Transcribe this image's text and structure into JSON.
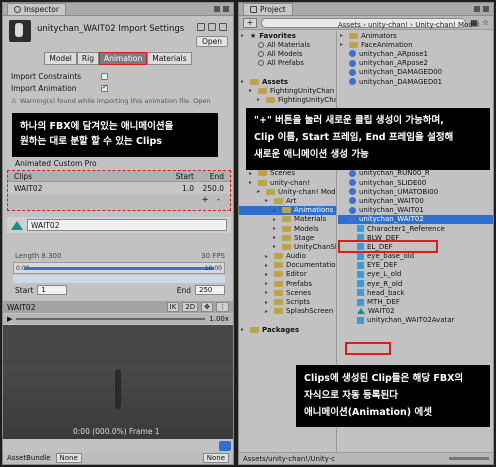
{
  "inspector": {
    "tab_label": "Inspector",
    "title": "unitychan_WAIT02 Import Settings",
    "open_label": "Open",
    "tabs": [
      "Model",
      "Rig",
      "Animation",
      "Materials"
    ],
    "import_constraints_label": "Import Constraints",
    "import_animation_label": "Import Animation",
    "warning_text": "Warning(s) found while importing this animation file. Open",
    "overlay_text_line1": "하나의 FBX에 담겨있는 애니메이션을",
    "overlay_text_line2": "원하는 대로 분할 할 수 있는 Clips",
    "animated_custom_label": "Animated Custom Pro",
    "clips": {
      "headers": [
        "Clips",
        "Start",
        "End"
      ],
      "rows": [
        {
          "name": "WAIT02",
          "start": "1.0",
          "end": "250.0"
        }
      ],
      "add_label": "+",
      "remove_label": "-"
    },
    "clip_name": "WAIT02",
    "length_label": "Length",
    "length_value": "8.300",
    "fps_label": "30 FPS",
    "timeline_start": "0:00",
    "timeline_end": "10:00",
    "start_label": "Start",
    "start_value": "1",
    "end_label": "End",
    "end_value": "250",
    "preview_name": "WAIT02",
    "preview_ik": "IK",
    "preview_2d": "2D",
    "preview_speed": "1.00x",
    "frame_label": "0:00 (000.0%) Frame 1",
    "assetbundle_label": "AssetBundle",
    "assetbundle_value": "None",
    "assetbundle_variant": "None"
  },
  "project": {
    "tab_label": "Project",
    "add_label": "+",
    "breadcrumb": "Assets › unity-chan! › Unity-chan! Model",
    "tree": [
      {
        "label": "Favorites",
        "bold": true,
        "kind": "star",
        "indent": 0
      },
      {
        "label": "All Materials",
        "kind": "mag",
        "indent": 1
      },
      {
        "label": "All Models",
        "kind": "mag",
        "indent": 1
      },
      {
        "label": "All Prefabs",
        "kind": "mag",
        "indent": 1
      },
      {
        "label": "",
        "kind": "blank",
        "indent": 0
      },
      {
        "label": "Assets",
        "bold": true,
        "kind": "folder",
        "indent": 0
      },
      {
        "label": "FightingUnityChan",
        "kind": "folder",
        "indent": 1
      },
      {
        "label": "FightingUnityCha",
        "kind": "folder",
        "indent": 2
      },
      {
        "label": "",
        "kind": "blank",
        "indent": 0
      },
      {
        "label": "",
        "kind": "blank",
        "indent": 0
      },
      {
        "label": "",
        "kind": "blank",
        "indent": 0
      },
      {
        "label": "",
        "kind": "blank",
        "indent": 0
      },
      {
        "label": "",
        "kind": "blank",
        "indent": 0
      },
      {
        "label": "",
        "kind": "blank",
        "indent": 0
      },
      {
        "label": "Scripts",
        "kind": "folder",
        "indent": 2
      },
      {
        "label": "Scenes",
        "kind": "folder",
        "indent": 1
      },
      {
        "label": "unity-chan!",
        "kind": "folder",
        "indent": 1
      },
      {
        "label": "Unity-chan! Model",
        "kind": "folder",
        "indent": 2
      },
      {
        "label": "Art",
        "kind": "folder",
        "indent": 3
      },
      {
        "label": "Animations",
        "kind": "folder",
        "indent": 4,
        "sel": true
      },
      {
        "label": "Materials",
        "kind": "folder",
        "indent": 4
      },
      {
        "label": "Models",
        "kind": "folder",
        "indent": 4
      },
      {
        "label": "Stage",
        "kind": "folder",
        "indent": 4
      },
      {
        "label": "UnityChanSl",
        "kind": "folder",
        "indent": 4
      },
      {
        "label": "Audio",
        "kind": "folder",
        "indent": 3
      },
      {
        "label": "Documentation",
        "kind": "folder",
        "indent": 3
      },
      {
        "label": "Editor",
        "kind": "folder",
        "indent": 3
      },
      {
        "label": "Prefabs",
        "kind": "folder",
        "indent": 3
      },
      {
        "label": "Scenes",
        "kind": "folder",
        "indent": 3
      },
      {
        "label": "Scripts",
        "kind": "folder",
        "indent": 3
      },
      {
        "label": "SplashScreen",
        "kind": "folder",
        "indent": 3
      },
      {
        "label": "",
        "kind": "blank",
        "indent": 0
      },
      {
        "label": "Packages",
        "bold": true,
        "kind": "folder",
        "indent": 0
      }
    ],
    "files": [
      {
        "label": "Animators",
        "kind": "folder",
        "indent": 0
      },
      {
        "label": "FaceAnimation",
        "kind": "folder",
        "indent": 0
      },
      {
        "label": "unitychan_ARpose1",
        "kind": "anim",
        "indent": 0
      },
      {
        "label": "unitychan_ARpose2",
        "kind": "anim",
        "indent": 0
      },
      {
        "label": "unitychan_DAMAGED00",
        "kind": "anim",
        "indent": 0
      },
      {
        "label": "unitychan_DAMAGED01",
        "kind": "anim",
        "indent": 0
      },
      {
        "label": "",
        "kind": "blank",
        "indent": 0
      },
      {
        "label": "",
        "kind": "blank",
        "indent": 0
      },
      {
        "label": "",
        "kind": "blank",
        "indent": 0
      },
      {
        "label": "",
        "kind": "blank",
        "indent": 0
      },
      {
        "label": "",
        "kind": "blank",
        "indent": 0
      },
      {
        "label": "",
        "kind": "blank",
        "indent": 0
      },
      {
        "label": "",
        "kind": "blank",
        "indent": 0
      },
      {
        "label": "unitychan_RUN00_F",
        "kind": "anim",
        "indent": 0
      },
      {
        "label": "unitychan_RUN00_L",
        "kind": "anim",
        "indent": 0
      },
      {
        "label": "unitychan_RUN00_R",
        "kind": "anim",
        "indent": 0
      },
      {
        "label": "unitychan_SLIDE00",
        "kind": "anim",
        "indent": 0
      },
      {
        "label": "unitychan_UMATOBI00",
        "kind": "anim",
        "indent": 0
      },
      {
        "label": "unitychan_WAIT00",
        "kind": "anim",
        "indent": 0
      },
      {
        "label": "unitychan_WAIT01",
        "kind": "anim",
        "indent": 0
      },
      {
        "label": "unitychan_WAIT02",
        "kind": "anim",
        "indent": 0,
        "sel": true
      },
      {
        "label": "Character1_Reference",
        "kind": "prefab",
        "indent": 1
      },
      {
        "label": "BLW_DEF",
        "kind": "prefab",
        "indent": 1
      },
      {
        "label": "EL_DEF",
        "kind": "prefab",
        "indent": 1
      },
      {
        "label": "eye_base_old",
        "kind": "prefab",
        "indent": 1
      },
      {
        "label": "EYE_DEF",
        "kind": "prefab",
        "indent": 1
      },
      {
        "label": "eye_L_old",
        "kind": "prefab",
        "indent": 1
      },
      {
        "label": "eye_R_old",
        "kind": "prefab",
        "indent": 1
      },
      {
        "label": "head_back",
        "kind": "prefab",
        "indent": 1
      },
      {
        "label": "MTH_DEF",
        "kind": "prefab",
        "indent": 1
      },
      {
        "label": "WAIT02",
        "kind": "clip",
        "indent": 1
      },
      {
        "label": "unitychan_WAIT02Avatar",
        "kind": "prefab",
        "indent": 1
      },
      {
        "label": "",
        "kind": "blank",
        "indent": 0
      },
      {
        "label": "",
        "kind": "blank",
        "indent": 0
      },
      {
        "label": "",
        "kind": "blank",
        "indent": 0
      },
      {
        "label": "",
        "kind": "blank",
        "indent": 0
      },
      {
        "label": "",
        "kind": "blank",
        "indent": 0
      },
      {
        "label": "",
        "kind": "blank",
        "indent": 0
      },
      {
        "label": "unitychan_WIN00",
        "kind": "anim",
        "indent": 0
      }
    ],
    "overlay_top_line1": "\"+\" 버튼을 눌러 새로운 클립 생성이 가능하며,",
    "overlay_top_line2": "Clip 이름, Start 프레임, End 프레임을 설정해",
    "overlay_top_line3": "새로운 애니메이션 생성 가능",
    "overlay_bottom_line1": "Clips에 생성된 Clip들은 해당 FBX의",
    "overlay_bottom_line2": "자식으로 자동 등록된다",
    "overlay_bottom_line3": "애니메이션(Animation) 에셋",
    "status_path": "Assets/unity-chan!/Unity-c"
  },
  "colors": {
    "highlight": "#d91c1c",
    "selection": "#2f6fd0",
    "overlay_bg": "#000000"
  }
}
